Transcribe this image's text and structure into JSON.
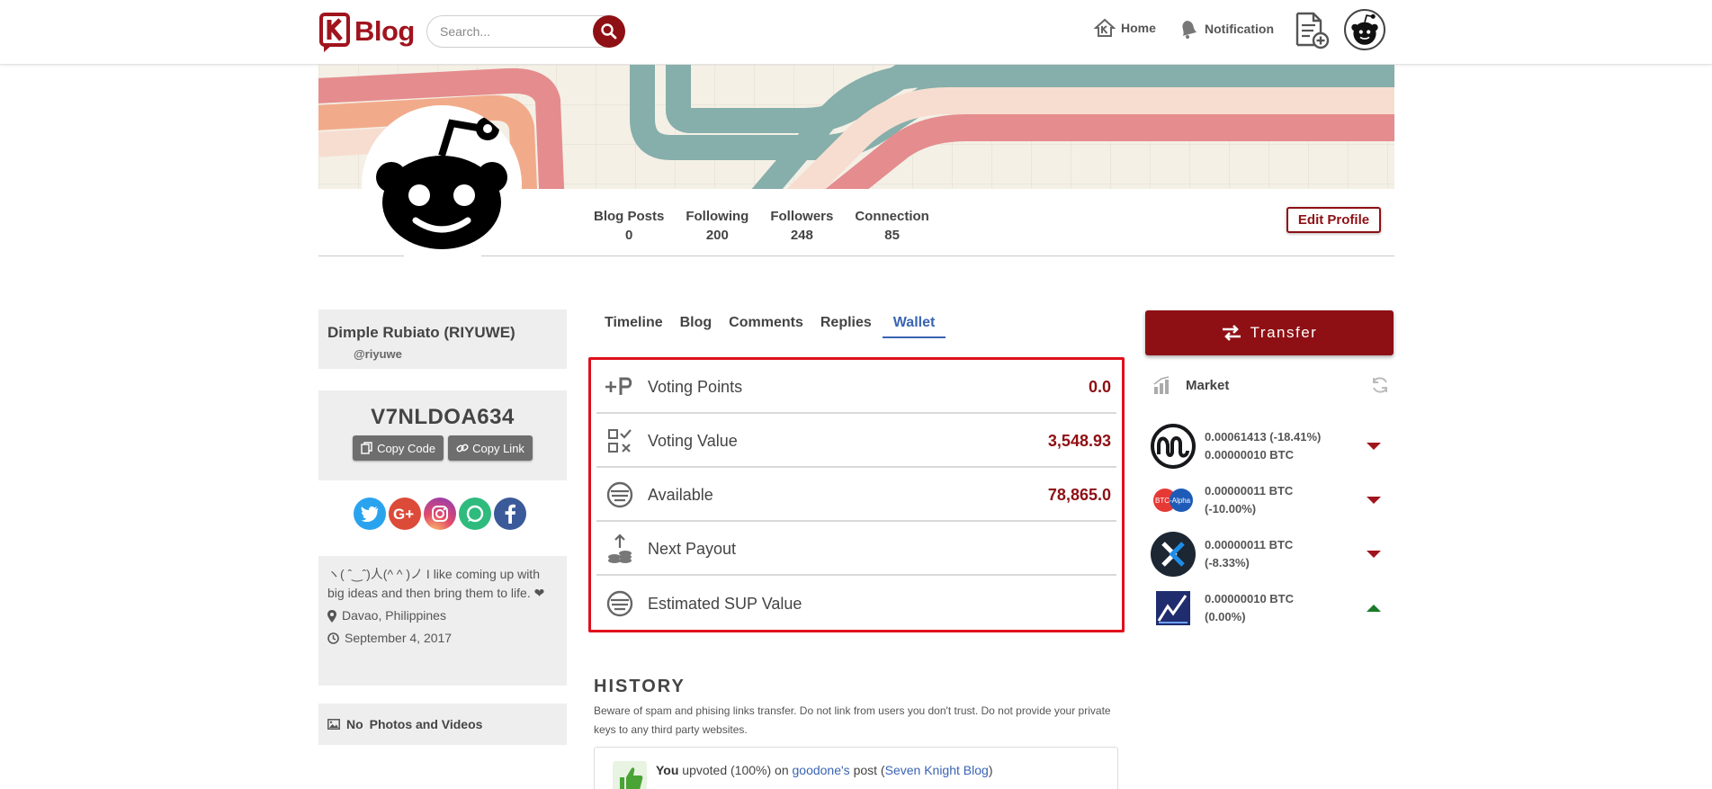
{
  "header": {
    "logo_text": "Blog",
    "search_placeholder": "Search...",
    "home_label": "Home",
    "notification_label": "Notification"
  },
  "profile": {
    "stats": [
      {
        "label": "Blog Posts",
        "value": "0"
      },
      {
        "label": "Following",
        "value": "200"
      },
      {
        "label": "Followers",
        "value": "248"
      },
      {
        "label": "Connection",
        "value": "85"
      }
    ],
    "edit_profile_label": "Edit Profile"
  },
  "sidebar": {
    "display_name": "Dimple Rubiato (RIYUWE)",
    "handle": "@riyuwe",
    "referral_code": "V7NLDOA634",
    "copy_code_label": "Copy Code",
    "copy_link_label": "Copy Link",
    "socials": [
      "twitter-icon",
      "google-plus-icon",
      "instagram-icon",
      "chat-icon",
      "facebook-icon"
    ],
    "bio": "ヽ( ˆ‿ˆ)人(^ ^ )ノ I like coming up with big ideas and then bring them to life. ❤",
    "location": "Davao, Philippines",
    "joined": "September 4, 2017",
    "media_prefix": "No",
    "media_label": "Photos and Videos"
  },
  "tabs": [
    {
      "label": "Timeline",
      "active": false
    },
    {
      "label": "Blog",
      "active": false
    },
    {
      "label": "Comments",
      "active": false
    },
    {
      "label": "Replies",
      "active": false
    },
    {
      "label": "Wallet",
      "active": true
    }
  ],
  "wallet": {
    "rows": [
      {
        "label": "Voting Points",
        "value": "0.0",
        "icon": "plus-p-icon"
      },
      {
        "label": "Voting Value",
        "value": "3,548.93",
        "icon": "qr-check-icon"
      },
      {
        "label": "Available",
        "value": "78,865.0",
        "icon": "sup-coin-icon"
      },
      {
        "label": "Next Payout",
        "value": "",
        "icon": "payout-coins-icon"
      },
      {
        "label": "Estimated SUP Value",
        "value": "",
        "icon": "sup-coin-icon"
      }
    ]
  },
  "history": {
    "title": "HISTORY",
    "note": "Beware of spam and phising links transfer. Do not link from users you don't trust. Do not provide your private keys to any third party websites.",
    "entry": {
      "actor": "You",
      "action": "upvoted (100%) on",
      "user": "goodone's",
      "post_word": "post",
      "post_title": "Seven Knight Blog"
    }
  },
  "right": {
    "transfer_label": "Transfer",
    "market_label": "Market",
    "market": [
      {
        "line1": "0.00061413 (-18.41%)",
        "line2": "0.00000010 BTC",
        "trend": "down",
        "coin": "coinmarketcap-icon"
      },
      {
        "line1": "0.00000011 BTC",
        "line2": "(-10.00%)",
        "trend": "down",
        "coin": "btc-alpha-icon"
      },
      {
        "line1": "0.00000011 BTC",
        "line2": "(-8.33%)",
        "trend": "down",
        "coin": "exchange-x-icon"
      },
      {
        "line1": "0.00000010 BTC",
        "line2": "(0.00%)",
        "trend": "up",
        "coin": "chart-icon"
      }
    ]
  },
  "colors": {
    "brand": "#8e1014",
    "accent_blue": "#3a64b2",
    "highlight_border": "#e0101c"
  }
}
